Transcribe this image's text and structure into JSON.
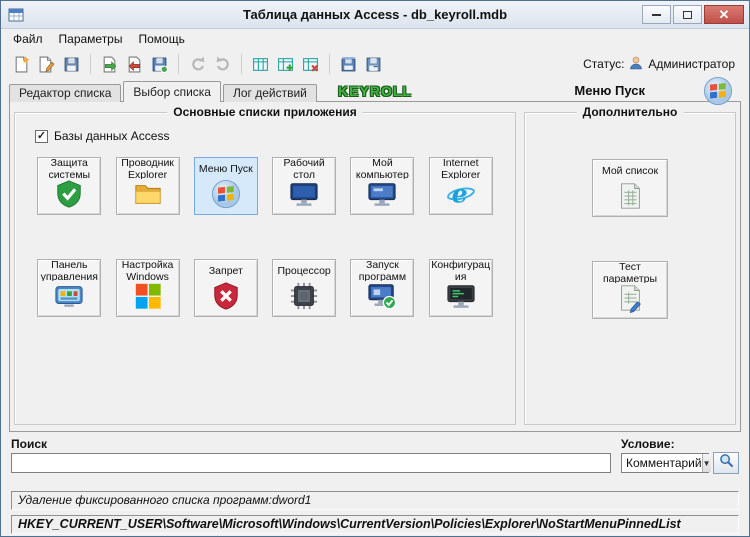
{
  "window": {
    "title": "Таблица данных Access - db_keyroll.mdb"
  },
  "menu": {
    "items": [
      {
        "label": "Файл"
      },
      {
        "label": "Параметры"
      },
      {
        "label": "Помощь"
      }
    ]
  },
  "toolbar": {
    "icons": [
      "new-document",
      "edit-document",
      "save-document",
      "export-document",
      "import-document",
      "save-colored",
      "undo",
      "redo",
      "list-table",
      "list-table-add",
      "list-table-remove",
      "database-save",
      "database-save-alt",
      "search"
    ],
    "status_label": "Статус:",
    "status_user": "Администратор"
  },
  "tab_bar": {
    "tabs": [
      {
        "label": "Редактор списка",
        "active": false
      },
      {
        "label": "Выбор списка",
        "active": true
      },
      {
        "label": "Лог действий",
        "active": false
      }
    ],
    "brand": "KEYROLL",
    "selection_title": "Меню Пуск"
  },
  "main_group": {
    "title": "Основные списки приложения",
    "checkbox": {
      "label": "Базы данных Access",
      "checked": true
    },
    "items": [
      {
        "label": "Защита системы",
        "icon": "shield-check-icon",
        "selected": false
      },
      {
        "label": "Проводник Explorer",
        "icon": "folder-icon",
        "selected": false
      },
      {
        "label": "Меню Пуск",
        "icon": "windows-orb-icon",
        "selected": true
      },
      {
        "label": "Рабочий стол",
        "icon": "monitor-icon",
        "selected": false
      },
      {
        "label": "Мой компьютер",
        "icon": "computer-icon",
        "selected": false
      },
      {
        "label": "Internet Explorer",
        "icon": "internet-explorer-icon",
        "selected": false
      },
      {
        "label": "Панель управления",
        "icon": "control-panel-icon",
        "selected": false
      },
      {
        "label": "Настройка Windows",
        "icon": "windows-squares-icon",
        "selected": false
      },
      {
        "label": "Запрет",
        "icon": "shield-x-icon",
        "selected": false
      },
      {
        "label": "Процессор",
        "icon": "cpu-icon",
        "selected": false
      },
      {
        "label": "Запуск программ",
        "icon": "monitor-check-icon",
        "selected": false
      },
      {
        "label": "Конфигурация",
        "icon": "monitor-config-icon",
        "selected": false
      }
    ]
  },
  "extra_group": {
    "title": "Дополнительно",
    "items": [
      {
        "label": "Мой список",
        "icon": "spreadsheet-icon"
      },
      {
        "label": "Тест параметры",
        "icon": "spreadsheet-params-icon"
      }
    ]
  },
  "search": {
    "label": "Поиск",
    "value": "",
    "condition_label": "Условие:",
    "condition_value": "Комментарий"
  },
  "status_bars": {
    "line1": "Удаление фиксированного списка программ:dword1",
    "line2": "HKEY_CURRENT_USER\\Software\\Microsoft\\Windows\\CurrentVersion\\Policies\\Explorer\\NoStartMenuPinnedList"
  },
  "colors": {
    "brand_green": "#45b045",
    "selection_blue": "#d6e9fb",
    "close_red": "#c0504a"
  }
}
